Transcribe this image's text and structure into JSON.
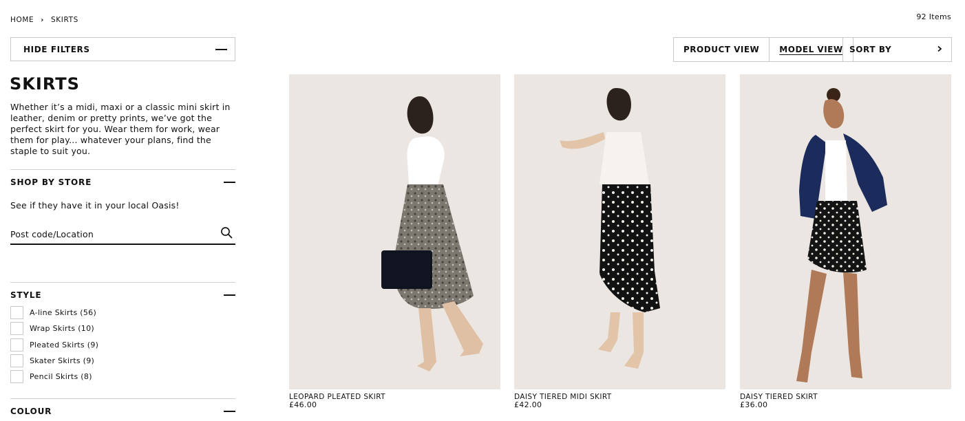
{
  "breadcrumb": {
    "home": "HOME",
    "current": "SKIRTS"
  },
  "item_count": "92 Items",
  "filters": {
    "toggle_label": "HIDE FILTERS"
  },
  "category": {
    "title": "SKIRTS",
    "description": "Whether it’s a midi, maxi or a classic mini skirt in leather, denim or pretty prints, we’ve got the perfect skirt for you. Wear them for work, wear them for play... whatever your plans, find the staple to suit you."
  },
  "shop_by_store": {
    "heading": "SHOP BY STORE",
    "text": "See if they have it in your local Oasis!",
    "placeholder": "Post code/Location"
  },
  "style": {
    "heading": "STYLE",
    "options": [
      {
        "label": "A-line Skirts (56)"
      },
      {
        "label": "Wrap Skirts (10)"
      },
      {
        "label": "Pleated Skirts (9)"
      },
      {
        "label": "Skater Skirts (9)"
      },
      {
        "label": "Pencil Skirts (8)"
      }
    ]
  },
  "colour": {
    "heading": "COLOUR"
  },
  "toolbar": {
    "product_view": "PRODUCT VIEW",
    "model_view": "MODEL VIEW",
    "sort_by": "SORT BY"
  },
  "products": [
    {
      "name": "LEOPARD PLEATED SKIRT",
      "price": "£46.00"
    },
    {
      "name": "DAISY TIERED MIDI SKIRT",
      "price": "£42.00"
    },
    {
      "name": "DAISY TIERED SKIRT",
      "price": "£36.00"
    }
  ],
  "icons": {
    "search": "search-icon",
    "collapse": "minus-icon",
    "sort_arrow": "chevron-right-icon"
  },
  "colors": {
    "text": "#111111",
    "border": "#c8c8c8",
    "photo_bg": "#ebe6e1"
  }
}
